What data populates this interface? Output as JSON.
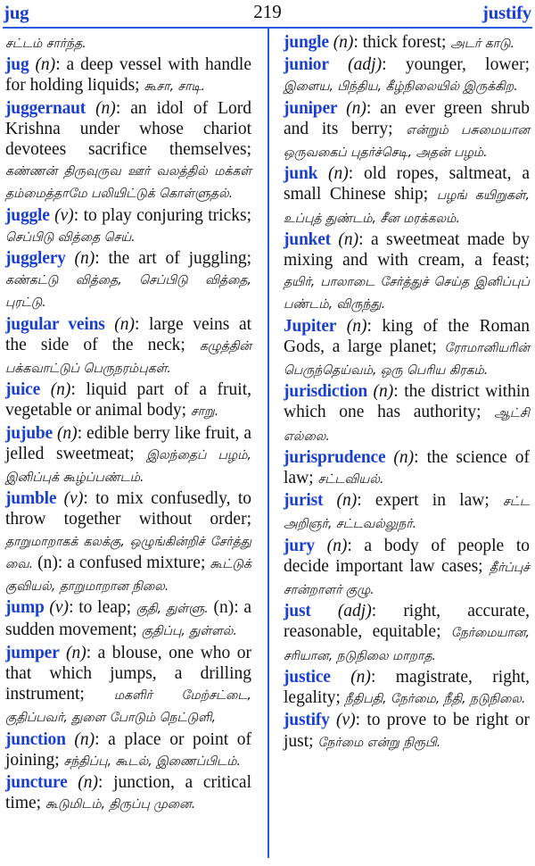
{
  "header": {
    "first_word": "jug",
    "page_number": "219",
    "last_word": "justify"
  },
  "colors": {
    "headword": "#1a3fd0",
    "rule": "#2a5bd8",
    "text": "#111111"
  },
  "left_column": {
    "continuation": "சட்டம் சார்ந்த.",
    "entries": [
      {
        "headword": "jug",
        "pos": "(n)",
        "definition": ": a deep vessel with handle for holding liquids; ",
        "tamil": "கூசா, சாடி."
      },
      {
        "headword": "juggernaut",
        "pos": "(n)",
        "definition": ": an idol of Lord Krishna under whose chariot devotees sacrifice themselves; ",
        "tamil": "கண்ணன் திருவுருவ ஊர் வலத்தில் மக்கள் தம்மைத்தாமே பலியிட்டுக் கொள்ளுதல்."
      },
      {
        "headword": "juggle",
        "pos": "(v)",
        "definition": ": to play conjuring tricks; ",
        "tamil": "செப்பிடு வித்தை செய்."
      },
      {
        "headword": "jugglery",
        "pos": "(n)",
        "definition": ": the art of juggling; ",
        "tamil": "கண்கட்டு வித்தை, செப்பிடு வித்தை, புரட்டு."
      },
      {
        "headword": "jugular veins",
        "pos": "(n)",
        "definition": ": large veins at the side of the neck; ",
        "tamil": "கழுத்தின் பக்கவாட்டுப் பெருநரம்புகள்."
      },
      {
        "headword": "juice",
        "pos": "(n)",
        "definition": ": liquid part of a fruit, vegetable or animal body; ",
        "tamil": "சாறு."
      },
      {
        "headword": "jujube",
        "pos": "(n)",
        "definition": ": edible berry like fruit, a jelled sweetmeat; ",
        "tamil": "இலந்தைப் பழம், இனிப்புக் கூழ்ப்பண்டம்."
      },
      {
        "headword": "jumble",
        "pos": "(v)",
        "definition": ": to mix confusedly, to throw together without order; ",
        "tamil": "தாறுமாறாகக் கலக்கு, ஒழுங்கின்றிச் சேர்த்து வை.",
        "definition2": " (n): a confused mixture; ",
        "tamil2": "கூட்டுக் குவியல், தாறுமாறான நிலை."
      },
      {
        "headword": "jump",
        "pos": "(v)",
        "definition": ": to leap; ",
        "tamil": "குதி, துள்ளு.",
        "definition2": " (n): a sudden movement; ",
        "tamil2": "குதிப்பு, துள்ளல்."
      },
      {
        "headword": "jumper",
        "pos": "(n)",
        "definition": ": a blouse, one who or that which jumps, a drilling instrument; ",
        "tamil": "மகளிர் மேற்சட்டை, குதிப்பவர், துளை போடும் நெட்டுளி,"
      },
      {
        "headword": "junction",
        "pos": "(n)",
        "definition": ": a place or point of joining; ",
        "tamil": "சந்திப்பு, கூடல், இணைப்பிடம்."
      },
      {
        "headword": "juncture",
        "pos": "(n)",
        "definition": ": junction, a critical time; ",
        "tamil": "கூடுமிடம், திருப்பு முனை."
      }
    ]
  },
  "right_column": {
    "entries": [
      {
        "headword": "jungle",
        "pos": "(n)",
        "definition": ": thick forest; ",
        "tamil": "அடர் காடு."
      },
      {
        "headword": "junior",
        "pos": "(adj)",
        "definition": ": younger, lower; ",
        "tamil": "இளைய, பிந்திய, கீழ்நிலையில் இருக்கிற."
      },
      {
        "headword": "juniper",
        "pos": "(n)",
        "definition": ": an ever green shrub and its berry; ",
        "tamil": "என்றும் பசுமையான ஒருவகைப் புதர்ச்செடி, அதன் பழம்."
      },
      {
        "headword": "junk",
        "pos": "(n)",
        "definition": ": old ropes, saltmeat, a small Chinese ship; ",
        "tamil": "பழங் கயிறுகள், உப்புத் துண்டம், சீன மரக்கலம்."
      },
      {
        "headword": "junket",
        "pos": "(n)",
        "definition": ": a sweetmeat made by mixing and with cream, a feast; ",
        "tamil": "தயிர், பாலாடை சேர்த்துச் செய்த இனிப்புப் பண்டம், விருந்து."
      },
      {
        "headword": "Jupiter",
        "pos": "(n)",
        "definition": ": king of the Roman Gods, a large planet; ",
        "tamil": "ரோமானியரின் பெருந்தெய்வம், ஒரு பெரிய கிரகம்."
      },
      {
        "headword": "jurisdiction",
        "pos": "(n)",
        "definition": ": the district within which one has authority; ",
        "tamil": "ஆட்சி எல்லை."
      },
      {
        "headword": "jurisprudence",
        "pos": "(n)",
        "definition": ": the science of law; ",
        "tamil": "சட்டவியல்."
      },
      {
        "headword": "jurist",
        "pos": "(n)",
        "definition": ": expert in law; ",
        "tamil": "சட்ட அறிஞர், சட்டவல்லுநர்."
      },
      {
        "headword": "jury",
        "pos": "(n)",
        "definition": ": a body of people to decide important law cases; ",
        "tamil": "தீர்ப்புச் சான்றாளர் குழு."
      },
      {
        "headword": "just",
        "pos": "(adj)",
        "definition": ": right, accurate, reasonable, equitable; ",
        "tamil": "நேர்மையான, சரியான, நடுநிலை மாறாத."
      },
      {
        "headword": "justice",
        "pos": "(n)",
        "definition": ": magistrate, right, legality; ",
        "tamil": "நீதிபதி, நேர்மை, நீதி, நடுநிலை."
      },
      {
        "headword": "justify",
        "pos": "(v)",
        "definition": ": to prove to be right or just; ",
        "tamil": "நேர்மை என்று நிரூபி."
      }
    ]
  }
}
